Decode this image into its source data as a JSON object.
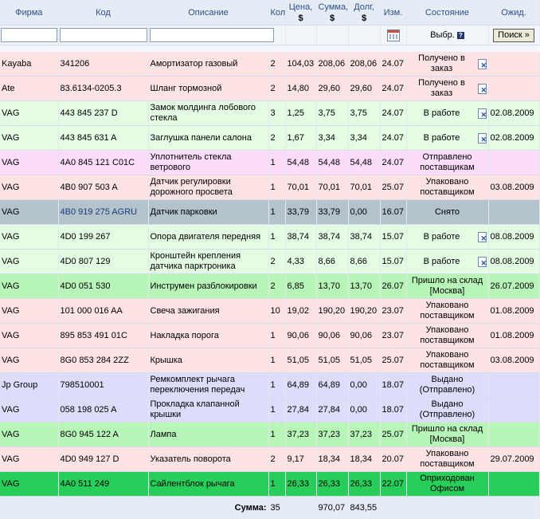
{
  "headers": {
    "firm": "Фирма",
    "code": "Код",
    "desc": "Описание",
    "qty": "Кол",
    "price_l1": "Цена,",
    "price_l2": "$",
    "sum_l1": "Сумма,",
    "sum_l2": "$",
    "debt_l1": "Долг,",
    "debt_l2": "$",
    "changed": "Изм.",
    "state": "Состояние",
    "expected": "Ожид."
  },
  "filters": {
    "firm_value": "",
    "code_value": "",
    "desc_value": "",
    "select_label": "Выбр.",
    "help": "?",
    "search_button": "Поиск »"
  },
  "rows": [
    {
      "firm": "Kayaba",
      "code": "341206",
      "desc": "Амортизатор газовый",
      "qty": "2",
      "price": "104,03",
      "sum": "208,06",
      "debt": "208,06",
      "changed": "24.07",
      "state": "Получено в заказ",
      "icon": true,
      "expected": "",
      "color": "pink"
    },
    {
      "firm": "Ate",
      "code": "83.6134-0205.3",
      "desc": "Шланг тормозной",
      "qty": "2",
      "price": "14,80",
      "sum": "29,60",
      "debt": "29,60",
      "changed": "24.07",
      "state": "Получено в заказ",
      "icon": true,
      "expected": "",
      "color": "pink"
    },
    {
      "firm": "VAG",
      "code": "443 845 237 D",
      "desc": "Замок молдинга лобового стекла",
      "qty": "3",
      "price": "1,25",
      "sum": "3,75",
      "debt": "3,75",
      "changed": "24.07",
      "state": "В работе",
      "icon": true,
      "expected": "02.08.2009",
      "color": "green"
    },
    {
      "firm": "VAG",
      "code": "443 845 631 A",
      "desc": "Заглушка панели салона",
      "qty": "2",
      "price": "1,67",
      "sum": "3,34",
      "debt": "3,34",
      "changed": "24.07",
      "state": "В работе",
      "icon": true,
      "expected": "02.08.2009",
      "color": "green"
    },
    {
      "firm": "VAG",
      "code": "4A0 845 121 C01C",
      "desc": "Уплотнитель стекла ветрового",
      "qty": "1",
      "price": "54,48",
      "sum": "54,48",
      "debt": "54,48",
      "changed": "24.07",
      "state": "Отправлено поставщикам",
      "icon": false,
      "expected": "",
      "color": "magenta"
    },
    {
      "firm": "VAG",
      "code": "4B0 907 503 A",
      "desc": "Датчик регулировки дорожного просвета",
      "qty": "1",
      "price": "70,01",
      "sum": "70,01",
      "debt": "70,01",
      "changed": "25.07",
      "state": "Упаковано поставщиком",
      "icon": false,
      "expected": "03.08.2009",
      "color": "pink"
    },
    {
      "firm": "VAG",
      "code": "4B0 919 275 AGRU",
      "desc": "Датчик парковки",
      "qty": "1",
      "price": "33,79",
      "sum": "33,79",
      "debt": "0,00",
      "changed": "16.07",
      "state": "Снято",
      "icon": false,
      "expected": "",
      "color": "grey"
    },
    {
      "firm": "VAG",
      "code": "4D0 199 267",
      "desc": "Опора двигателя передняя",
      "qty": "1",
      "price": "38,74",
      "sum": "38,74",
      "debt": "38,74",
      "changed": "15.07",
      "state": "В работе",
      "icon": true,
      "expected": "08.08.2009",
      "color": "green"
    },
    {
      "firm": "VAG",
      "code": "4D0 807 129",
      "desc": "Кронштейн крепления датчика парктроника",
      "qty": "2",
      "price": "4,33",
      "sum": "8,66",
      "debt": "8,66",
      "changed": "15.07",
      "state": "В работе",
      "icon": true,
      "expected": "08.08.2009",
      "color": "green"
    },
    {
      "firm": "VAG",
      "code": "4D0 051 530",
      "desc": "Инструмен разблокировки",
      "qty": "2",
      "price": "6,85",
      "sum": "13,70",
      "debt": "13,70",
      "changed": "26.07",
      "state": "Пришло на склад [Москва]",
      "icon": false,
      "expected": "26.07.2009",
      "color": "lightgreen"
    },
    {
      "firm": "VAG",
      "code": "101 000 016 AA",
      "desc": "Свеча зажигания",
      "qty": "10",
      "price": "19,02",
      "sum": "190,20",
      "debt": "190,20",
      "changed": "23.07",
      "state": "Упаковано поставщиком",
      "icon": false,
      "expected": "01.08.2009",
      "color": "pink"
    },
    {
      "firm": "VAG",
      "code": "895 853 491 01C",
      "desc": "Накладка порога",
      "qty": "1",
      "price": "90,06",
      "sum": "90,06",
      "debt": "90,06",
      "changed": "23.07",
      "state": "Упаковано поставщиком",
      "icon": false,
      "expected": "01.08.2009",
      "color": "pink"
    },
    {
      "firm": "VAG",
      "code": "8G0 853 284 2ZZ",
      "desc": "Крышка",
      "qty": "1",
      "price": "51,05",
      "sum": "51,05",
      "debt": "51,05",
      "changed": "25.07",
      "state": "Упаковано поставщиком",
      "icon": false,
      "expected": "03.08.2009",
      "color": "pink"
    },
    {
      "firm": "Jp Group",
      "code": "798510001",
      "desc": "Ремкомплект рычага переключения передач",
      "qty": "1",
      "price": "64,89",
      "sum": "64,89",
      "debt": "0,00",
      "changed": "18.07",
      "state": "Выдано (Отправлено)",
      "icon": false,
      "expected": "",
      "color": "lavender"
    },
    {
      "firm": "VAG",
      "code": "058 198 025 A",
      "desc": "Прокладка клапанной крышки",
      "qty": "1",
      "price": "27,84",
      "sum": "27,84",
      "debt": "0,00",
      "changed": "18.07",
      "state": "Выдано (Отправлено)",
      "icon": false,
      "expected": "",
      "color": "lavender"
    },
    {
      "firm": "VAG",
      "code": "8G0 945 122 A",
      "desc": "Лампа",
      "qty": "1",
      "price": "37,23",
      "sum": "37,23",
      "debt": "37,23",
      "changed": "25.07",
      "state": "Пришло на склад [Москва]",
      "icon": false,
      "expected": "",
      "color": "lightgreen"
    },
    {
      "firm": "VAG",
      "code": "4D0 949 127 D",
      "desc": "Указатель поворота",
      "qty": "2",
      "price": "9,17",
      "sum": "18,34",
      "debt": "18,34",
      "changed": "20.07",
      "state": "Упаковано поставщиком",
      "icon": false,
      "expected": "29.07.2009",
      "color": "pink"
    },
    {
      "firm": "VAG",
      "code": "4A0 511 249",
      "desc": "Сайлентблок рычага",
      "qty": "1",
      "price": "26,33",
      "sum": "26,33",
      "debt": "26,33",
      "changed": "22.07",
      "state": "Оприходован Офисом",
      "icon": false,
      "expected": "",
      "color": "brightgreen"
    }
  ],
  "footer": {
    "label": "Сумма:",
    "qty": "35",
    "sum": "970,07",
    "debt": "843,55"
  }
}
